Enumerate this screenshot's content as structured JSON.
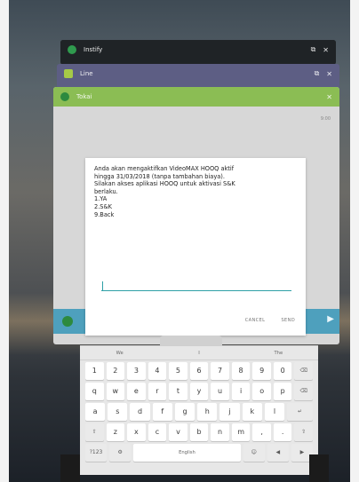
{
  "recent_apps": [
    {
      "title": "Instify",
      "bar_color": "#1f2326"
    },
    {
      "title": "Line",
      "bar_color": "#5d5e84"
    },
    {
      "title": "Tokai",
      "bar_color": "#8bbd54"
    }
  ],
  "card3_small_text": "9:00",
  "dialog": {
    "message_lines": [
      "Anda akan mengaktifkan VideoMAX HOOQ aktif",
      "hingga 31/03/2018 (tanpa tambahan biaya).",
      "Silakan akses aplikasi HOOQ untuk aktivasi S&K",
      "berlaku.",
      "1.YA",
      "2.S&K",
      "9.Back"
    ],
    "input_value": "",
    "cancel_label": "CANCEL",
    "send_label": "SEND"
  },
  "keyboard": {
    "suggestions": [
      "We",
      "I",
      "The"
    ],
    "row1": [
      "1",
      "2",
      "3",
      "4",
      "5",
      "6",
      "7",
      "8",
      "9",
      "0",
      "⌫"
    ],
    "row2": [
      "q",
      "w",
      "e",
      "r",
      "t",
      "y",
      "u",
      "i",
      "o",
      "p",
      "⌫"
    ],
    "row3": [
      "a",
      "s",
      "d",
      "f",
      "g",
      "h",
      "j",
      "k",
      "l",
      "↵"
    ],
    "row4": [
      "⇧",
      "z",
      "x",
      "c",
      "v",
      "b",
      "n",
      "m",
      ",",
      ".",
      "⇧"
    ],
    "row5": {
      "sym": "?123",
      "settings": "⚙",
      "space": "English",
      "emoji": "☺",
      "left": "◀",
      "right": "▶"
    }
  }
}
